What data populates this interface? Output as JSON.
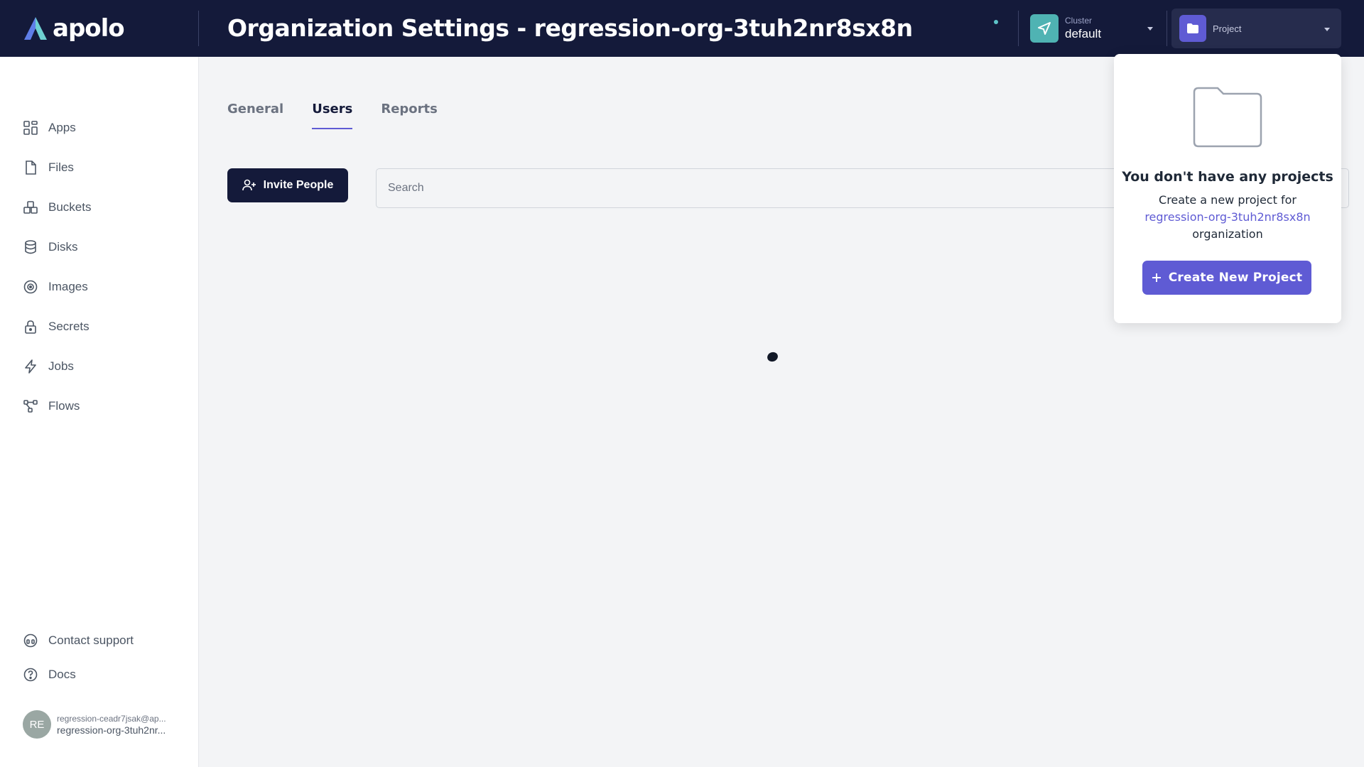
{
  "app": {
    "brand": "apolo",
    "page_title": "Organization Settings - regression-org-3tuh2nr8sx8n"
  },
  "header": {
    "cluster": {
      "label": "Cluster",
      "value": "default"
    },
    "project": {
      "label": "Project"
    }
  },
  "sidebar": {
    "items": [
      {
        "label": "Apps",
        "icon": "apps-grid-icon"
      },
      {
        "label": "Files",
        "icon": "file-icon"
      },
      {
        "label": "Buckets",
        "icon": "buckets-icon"
      },
      {
        "label": "Disks",
        "icon": "database-icon"
      },
      {
        "label": "Images",
        "icon": "image-disc-icon"
      },
      {
        "label": "Secrets",
        "icon": "lock-icon"
      },
      {
        "label": "Jobs",
        "icon": "lightning-icon"
      },
      {
        "label": "Flows",
        "icon": "flow-icon"
      }
    ],
    "bottom_items": [
      {
        "label": "Contact support",
        "icon": "headset-icon"
      },
      {
        "label": "Docs",
        "icon": "help-circle-icon"
      }
    ],
    "user": {
      "initials": "RE",
      "email": "regression-ceadr7jsak@ap...",
      "org": "regression-org-3tuh2nr..."
    }
  },
  "main": {
    "tabs": [
      {
        "label": "General",
        "active": false
      },
      {
        "label": "Users",
        "active": true
      },
      {
        "label": "Reports",
        "active": false
      }
    ],
    "invite_button": "Invite People",
    "search": {
      "placeholder": "Search",
      "value": ""
    }
  },
  "project_dropdown": {
    "title": "You don't have any projects",
    "text_line1": "Create a new project for",
    "org_name": "regression-org-3tuh2nr8sx8n",
    "text_line3": "organization",
    "create_button": "Create New Project"
  },
  "colors": {
    "topbar": "#141a3a",
    "accent": "#5f5bd4",
    "cluster_icon": "#4fb3b3",
    "brand_cyan": "#5ec4c8"
  }
}
